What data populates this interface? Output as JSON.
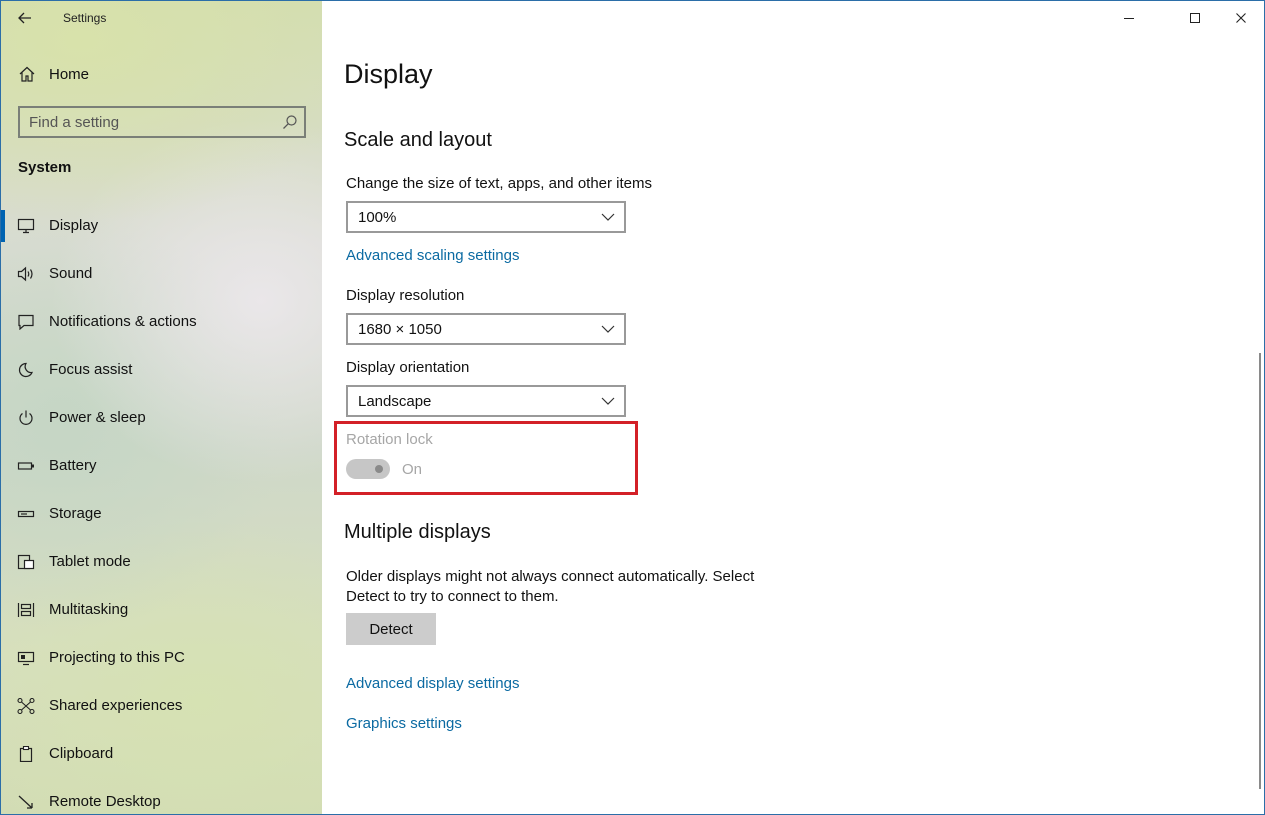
{
  "window": {
    "app_title": "Settings",
    "back_icon": "back-arrow-icon",
    "controls": {
      "minimize": "minimize-icon",
      "maximize": "maximize-icon",
      "close": "close-icon"
    }
  },
  "sidebar": {
    "home_label": "Home",
    "search_placeholder": "Find a setting",
    "section_label": "System",
    "items": [
      {
        "label": "Display",
        "icon": "monitor-icon",
        "active": true
      },
      {
        "label": "Sound",
        "icon": "speaker-icon"
      },
      {
        "label": "Notifications & actions",
        "icon": "notification-icon"
      },
      {
        "label": "Focus assist",
        "icon": "moon-icon"
      },
      {
        "label": "Power & sleep",
        "icon": "power-icon"
      },
      {
        "label": "Battery",
        "icon": "battery-icon"
      },
      {
        "label": "Storage",
        "icon": "storage-icon"
      },
      {
        "label": "Tablet mode",
        "icon": "tablet-icon"
      },
      {
        "label": "Multitasking",
        "icon": "multitasking-icon"
      },
      {
        "label": "Projecting to this PC",
        "icon": "projecting-icon"
      },
      {
        "label": "Shared experiences",
        "icon": "shared-icon"
      },
      {
        "label": "Clipboard",
        "icon": "clipboard-icon"
      },
      {
        "label": "Remote Desktop",
        "icon": "remote-desktop-icon"
      }
    ]
  },
  "main": {
    "page_title": "Display",
    "scale_heading": "Scale and layout",
    "scale_label": "Change the size of text, apps, and other items",
    "scale_value": "100%",
    "advanced_scaling_link": "Advanced scaling settings",
    "resolution_label": "Display resolution",
    "resolution_value": "1680 × 1050",
    "orientation_label": "Display orientation",
    "orientation_value": "Landscape",
    "rotation_lock_label": "Rotation lock",
    "rotation_lock_state": "On",
    "multiple_heading": "Multiple displays",
    "multiple_text": "Older displays might not always connect automatically. Select Detect to try to connect to them.",
    "detect_button": "Detect",
    "advanced_display_link": "Advanced display settings",
    "graphics_link": "Graphics settings"
  },
  "colors": {
    "accent": "#0063b1",
    "link": "#0b6aa2",
    "highlight_border": "#d32027",
    "disabled_text": "#a6a6a6"
  }
}
